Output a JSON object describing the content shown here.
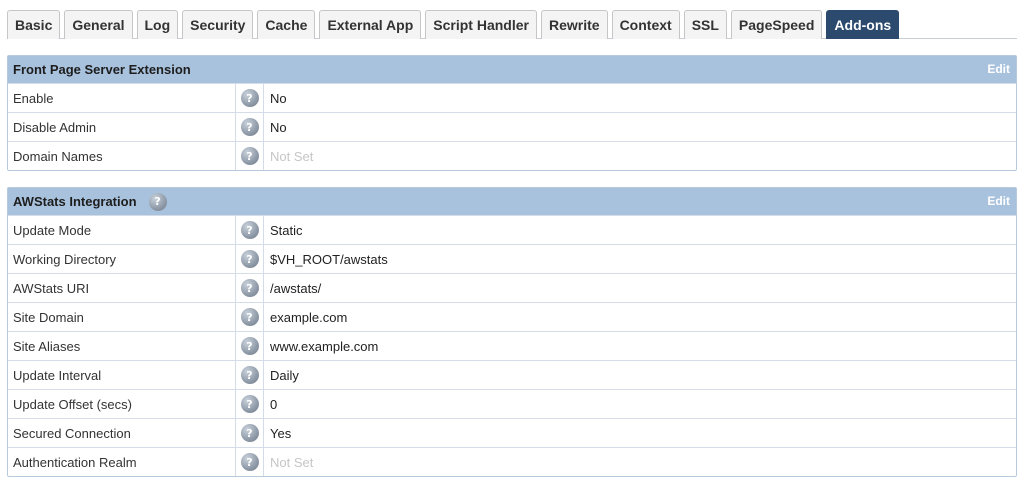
{
  "tabs": [
    {
      "label": "Basic"
    },
    {
      "label": "General"
    },
    {
      "label": "Log"
    },
    {
      "label": "Security"
    },
    {
      "label": "Cache"
    },
    {
      "label": "External App"
    },
    {
      "label": "Script Handler"
    },
    {
      "label": "Rewrite"
    },
    {
      "label": "Context"
    },
    {
      "label": "SSL"
    },
    {
      "label": "PageSpeed"
    },
    {
      "label": "Add-ons",
      "active": true
    }
  ],
  "help_glyph": "?",
  "frontpage": {
    "title": "Front Page Server Extension",
    "edit_label": "Edit",
    "rows": [
      {
        "label": "Enable",
        "value": "No"
      },
      {
        "label": "Disable Admin",
        "value": "No"
      },
      {
        "label": "Domain Names",
        "value": "Not Set",
        "not_set": true
      }
    ]
  },
  "awstats": {
    "title": "AWStats Integration",
    "edit_label": "Edit",
    "rows": [
      {
        "label": "Update Mode",
        "value": "Static"
      },
      {
        "label": "Working Directory",
        "value": "$VH_ROOT/awstats"
      },
      {
        "label": "AWStats URI",
        "value": "/awstats/"
      },
      {
        "label": "Site Domain",
        "value": "example.com"
      },
      {
        "label": "Site Aliases",
        "value": "www.example.com"
      },
      {
        "label": "Update Interval",
        "value": "Daily"
      },
      {
        "label": "Update Offset (secs)",
        "value": "0"
      },
      {
        "label": "Secured Connection",
        "value": "Yes"
      },
      {
        "label": "Authentication Realm",
        "value": "Not Set",
        "not_set": true
      }
    ]
  },
  "colors": {
    "active_tab": "#2b4a6e",
    "panel_header": "#a8c2de",
    "not_set_text": "#c6c6c6"
  }
}
